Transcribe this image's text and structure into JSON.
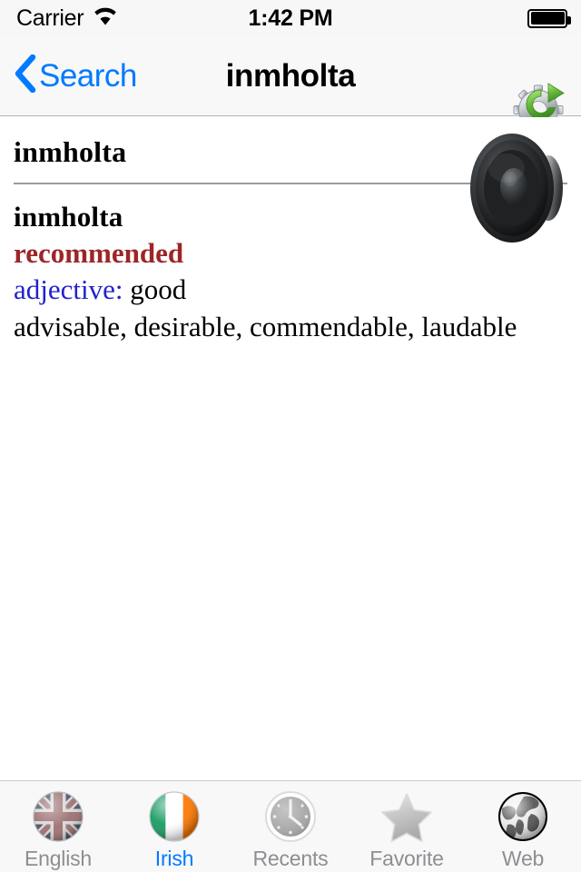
{
  "status_bar": {
    "carrier": "Carrier",
    "wifi_icon": "wifi-icon",
    "time": "1:42 PM",
    "battery_icon": "battery-full-icon"
  },
  "nav_bar": {
    "back_label": "Search",
    "back_icon": "chevron-left-icon",
    "title": "inmholta",
    "action_icon": "gear-refresh-icon"
  },
  "entry": {
    "headword": "inmholta",
    "speaker_icon": "speaker-icon",
    "sense": {
      "word": "inmholta",
      "tag": "recommended",
      "part_of_speech": "adjective:",
      "definition": "good",
      "synonyms": "advisable, desirable, commendable, laudable"
    }
  },
  "tab_bar": {
    "tabs": [
      {
        "label": "English",
        "icon": "uk-flag-icon",
        "active": false
      },
      {
        "label": "Irish",
        "icon": "ireland-flag-icon",
        "active": true
      },
      {
        "label": "Recents",
        "icon": "clock-icon",
        "active": false
      },
      {
        "label": "Favorite",
        "icon": "star-icon",
        "active": false
      },
      {
        "label": "Web",
        "icon": "globe-icon",
        "active": false
      }
    ]
  },
  "colors": {
    "accent_blue": "#007aff",
    "tag_red": "#9d2528",
    "pos_blue": "#2222cc",
    "inactive_gray": "#8e8e93",
    "bar_background": "#f8f8f8"
  }
}
